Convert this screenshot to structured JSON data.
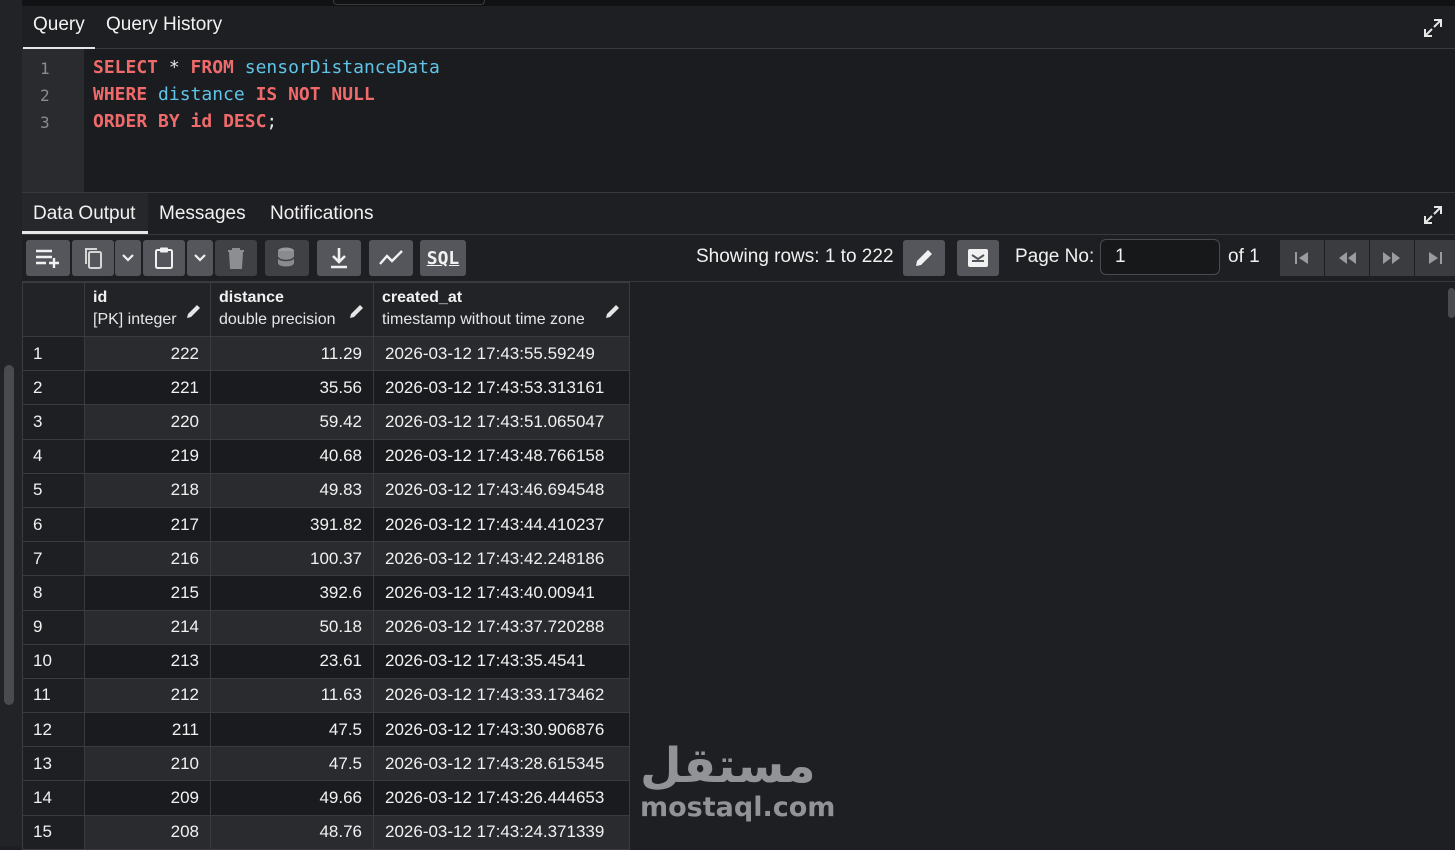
{
  "query_tabs": [
    "Query",
    "Query History"
  ],
  "editor": {
    "line_numbers": [
      "1",
      "2",
      "3"
    ],
    "line1": {
      "kw1": "SELECT",
      "star": " * ",
      "kw2": "FROM",
      "table": " sensorDistanceData"
    },
    "line2": {
      "kw1": "WHERE",
      "col": " distance ",
      "kw2": "IS NOT NULL"
    },
    "line3": {
      "kw1": "ORDER BY",
      "col": " id ",
      "kw2": "DESC",
      "end": ";"
    }
  },
  "output_tabs": [
    "Data Output",
    "Messages",
    "Notifications"
  ],
  "toolbar": {
    "showing_rows": "Showing rows: 1 to 222",
    "page_no_label": "Page No:",
    "page_no_value": "1",
    "of_label": "of 1",
    "sql_label": "SQL"
  },
  "columns": [
    {
      "name": "id",
      "type": "[PK] integer"
    },
    {
      "name": "distance",
      "type": "double precision"
    },
    {
      "name": "created_at",
      "type": "timestamp without time zone"
    }
  ],
  "rows": [
    [
      "1",
      "222",
      "11.29",
      "2026-03-12 17:43:55.59249"
    ],
    [
      "2",
      "221",
      "35.56",
      "2026-03-12 17:43:53.313161"
    ],
    [
      "3",
      "220",
      "59.42",
      "2026-03-12 17:43:51.065047"
    ],
    [
      "4",
      "219",
      "40.68",
      "2026-03-12 17:43:48.766158"
    ],
    [
      "5",
      "218",
      "49.83",
      "2026-03-12 17:43:46.694548"
    ],
    [
      "6",
      "217",
      "391.82",
      "2026-03-12 17:43:44.410237"
    ],
    [
      "7",
      "216",
      "100.37",
      "2026-03-12 17:43:42.248186"
    ],
    [
      "8",
      "215",
      "392.6",
      "2026-03-12 17:43:40.00941"
    ],
    [
      "9",
      "214",
      "50.18",
      "2026-03-12 17:43:37.720288"
    ],
    [
      "10",
      "213",
      "23.61",
      "2026-03-12 17:43:35.4541"
    ],
    [
      "11",
      "212",
      "11.63",
      "2026-03-12 17:43:33.173462"
    ],
    [
      "12",
      "211",
      "47.5",
      "2026-03-12 17:43:30.906876"
    ],
    [
      "13",
      "210",
      "47.5",
      "2026-03-12 17:43:28.615345"
    ],
    [
      "14",
      "209",
      "49.66",
      "2026-03-12 17:43:26.444653"
    ],
    [
      "15",
      "208",
      "48.76",
      "2026-03-12 17:43:24.371339"
    ]
  ],
  "watermark": {
    "arabic": "مستقل",
    "latin": "mostaql.com"
  },
  "colors": {
    "keyword": "#ef6b6b",
    "identifier": "#5fc4e8",
    "background": "#1e1f22"
  }
}
